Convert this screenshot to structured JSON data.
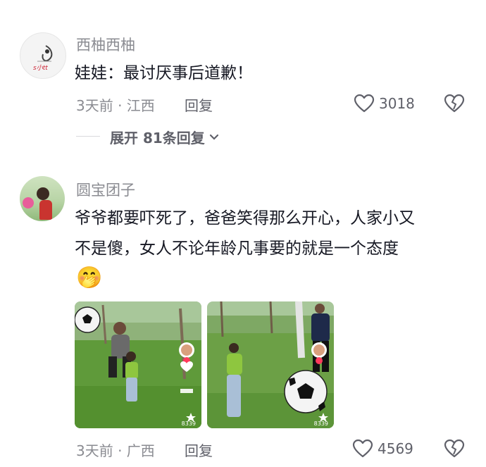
{
  "comments": [
    {
      "username": "西柚西柚",
      "text": "娃娃：最讨厌事后道歉！",
      "meta": "3天前 · 江西",
      "reply_label": "回复",
      "like_count": "3018",
      "expand_label": "展开 81条回复",
      "avatar_text": "s小tt"
    },
    {
      "username": "圆宝团子",
      "text_line1": "爷爷都要吓死了，爸爸笑得那么开心，人家小又",
      "text_line2": "不是傻，女人不论年龄凡事要的就是一个态度",
      "emoji": "🤭",
      "meta": "3天前 · 广西",
      "reply_label": "回复",
      "like_count": "4569",
      "media": [
        {
          "badge": "8339"
        },
        {
          "badge": "8339"
        }
      ]
    }
  ],
  "icons": [
    "heart-icon",
    "broken-heart-icon",
    "chevron-down-icon",
    "star-icon",
    "plus-icon"
  ],
  "colors": {
    "text": "#161823",
    "secondary": "#8a8b91",
    "action": "#5f6069",
    "grass": "#5f9a3a"
  }
}
